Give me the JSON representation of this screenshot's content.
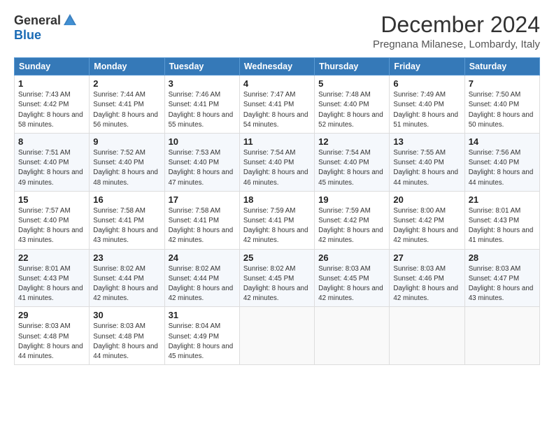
{
  "header": {
    "logo": {
      "general": "General",
      "blue": "Blue"
    },
    "title": "December 2024",
    "location": "Pregnana Milanese, Lombardy, Italy"
  },
  "weekdays": [
    "Sunday",
    "Monday",
    "Tuesday",
    "Wednesday",
    "Thursday",
    "Friday",
    "Saturday"
  ],
  "weeks": [
    [
      {
        "day": "1",
        "sunrise": "7:43 AM",
        "sunset": "4:42 PM",
        "daylight": "8 hours and 58 minutes."
      },
      {
        "day": "2",
        "sunrise": "7:44 AM",
        "sunset": "4:41 PM",
        "daylight": "8 hours and 56 minutes."
      },
      {
        "day": "3",
        "sunrise": "7:46 AM",
        "sunset": "4:41 PM",
        "daylight": "8 hours and 55 minutes."
      },
      {
        "day": "4",
        "sunrise": "7:47 AM",
        "sunset": "4:41 PM",
        "daylight": "8 hours and 54 minutes."
      },
      {
        "day": "5",
        "sunrise": "7:48 AM",
        "sunset": "4:40 PM",
        "daylight": "8 hours and 52 minutes."
      },
      {
        "day": "6",
        "sunrise": "7:49 AM",
        "sunset": "4:40 PM",
        "daylight": "8 hours and 51 minutes."
      },
      {
        "day": "7",
        "sunrise": "7:50 AM",
        "sunset": "4:40 PM",
        "daylight": "8 hours and 50 minutes."
      }
    ],
    [
      {
        "day": "8",
        "sunrise": "7:51 AM",
        "sunset": "4:40 PM",
        "daylight": "8 hours and 49 minutes."
      },
      {
        "day": "9",
        "sunrise": "7:52 AM",
        "sunset": "4:40 PM",
        "daylight": "8 hours and 48 minutes."
      },
      {
        "day": "10",
        "sunrise": "7:53 AM",
        "sunset": "4:40 PM",
        "daylight": "8 hours and 47 minutes."
      },
      {
        "day": "11",
        "sunrise": "7:54 AM",
        "sunset": "4:40 PM",
        "daylight": "8 hours and 46 minutes."
      },
      {
        "day": "12",
        "sunrise": "7:54 AM",
        "sunset": "4:40 PM",
        "daylight": "8 hours and 45 minutes."
      },
      {
        "day": "13",
        "sunrise": "7:55 AM",
        "sunset": "4:40 PM",
        "daylight": "8 hours and 44 minutes."
      },
      {
        "day": "14",
        "sunrise": "7:56 AM",
        "sunset": "4:40 PM",
        "daylight": "8 hours and 44 minutes."
      }
    ],
    [
      {
        "day": "15",
        "sunrise": "7:57 AM",
        "sunset": "4:40 PM",
        "daylight": "8 hours and 43 minutes."
      },
      {
        "day": "16",
        "sunrise": "7:58 AM",
        "sunset": "4:41 PM",
        "daylight": "8 hours and 43 minutes."
      },
      {
        "day": "17",
        "sunrise": "7:58 AM",
        "sunset": "4:41 PM",
        "daylight": "8 hours and 42 minutes."
      },
      {
        "day": "18",
        "sunrise": "7:59 AM",
        "sunset": "4:41 PM",
        "daylight": "8 hours and 42 minutes."
      },
      {
        "day": "19",
        "sunrise": "7:59 AM",
        "sunset": "4:42 PM",
        "daylight": "8 hours and 42 minutes."
      },
      {
        "day": "20",
        "sunrise": "8:00 AM",
        "sunset": "4:42 PM",
        "daylight": "8 hours and 42 minutes."
      },
      {
        "day": "21",
        "sunrise": "8:01 AM",
        "sunset": "4:43 PM",
        "daylight": "8 hours and 41 minutes."
      }
    ],
    [
      {
        "day": "22",
        "sunrise": "8:01 AM",
        "sunset": "4:43 PM",
        "daylight": "8 hours and 41 minutes."
      },
      {
        "day": "23",
        "sunrise": "8:02 AM",
        "sunset": "4:44 PM",
        "daylight": "8 hours and 42 minutes."
      },
      {
        "day": "24",
        "sunrise": "8:02 AM",
        "sunset": "4:44 PM",
        "daylight": "8 hours and 42 minutes."
      },
      {
        "day": "25",
        "sunrise": "8:02 AM",
        "sunset": "4:45 PM",
        "daylight": "8 hours and 42 minutes."
      },
      {
        "day": "26",
        "sunrise": "8:03 AM",
        "sunset": "4:45 PM",
        "daylight": "8 hours and 42 minutes."
      },
      {
        "day": "27",
        "sunrise": "8:03 AM",
        "sunset": "4:46 PM",
        "daylight": "8 hours and 42 minutes."
      },
      {
        "day": "28",
        "sunrise": "8:03 AM",
        "sunset": "4:47 PM",
        "daylight": "8 hours and 43 minutes."
      }
    ],
    [
      {
        "day": "29",
        "sunrise": "8:03 AM",
        "sunset": "4:48 PM",
        "daylight": "8 hours and 44 minutes."
      },
      {
        "day": "30",
        "sunrise": "8:03 AM",
        "sunset": "4:48 PM",
        "daylight": "8 hours and 44 minutes."
      },
      {
        "day": "31",
        "sunrise": "8:04 AM",
        "sunset": "4:49 PM",
        "daylight": "8 hours and 45 minutes."
      },
      null,
      null,
      null,
      null
    ]
  ],
  "labels": {
    "sunrise": "Sunrise:",
    "sunset": "Sunset:",
    "daylight": "Daylight:"
  }
}
